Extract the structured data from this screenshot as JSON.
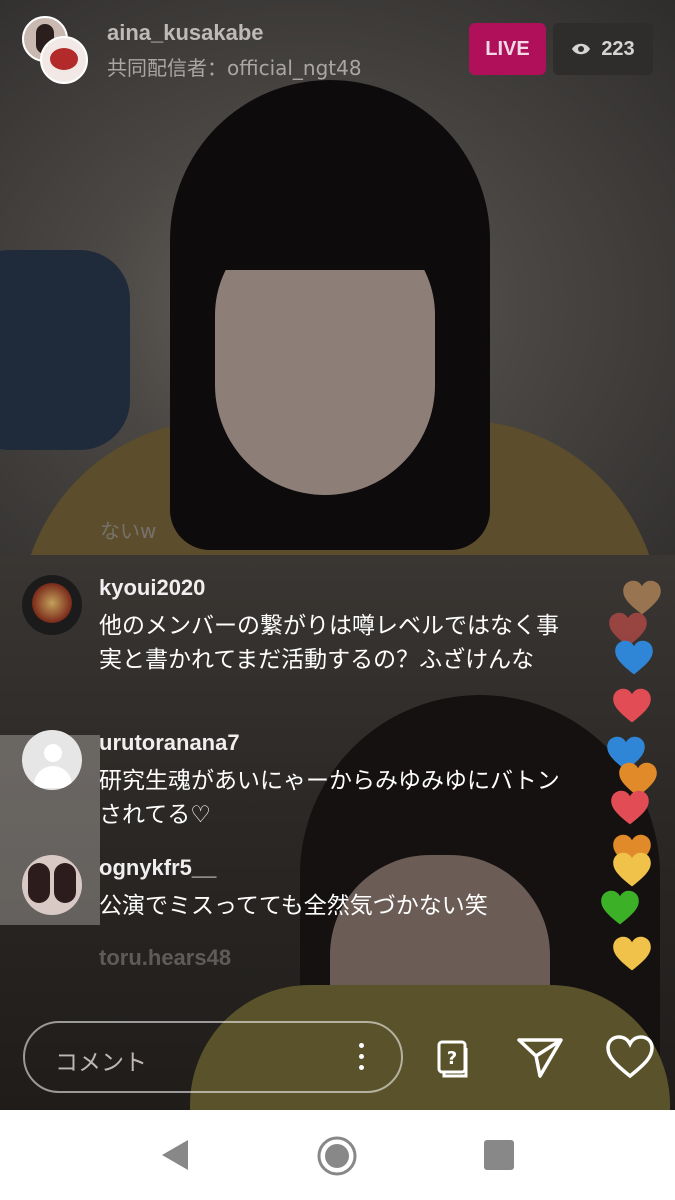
{
  "header": {
    "host_name": "aina_kusakabe",
    "cohost": "共同配信者：official_ngt48",
    "live_label": "LIVE",
    "viewer_count": "223"
  },
  "faded_comment": "ないw",
  "comments": [
    {
      "user": "kyoui2020",
      "text": "他のメンバーの繋がりは噂レベルではなく事実と書かれてまだ活動するの？ふざけんな"
    },
    {
      "user": "urutoranana7",
      "text": "研究生魂があいにゃーからみゆみゆにバトンされてる♡"
    },
    {
      "user": "ognykfr5__",
      "text": "公演でミスってても全然気づかない笑"
    },
    {
      "user": "toru.hears48",
      "text": ""
    }
  ],
  "hearts_colors": [
    "#d9a066",
    "#d9504c",
    "#2f86d6",
    "#e24c55",
    "#2f86d6",
    "#e08a2a",
    "#e24c55",
    "#e08a2a",
    "#f0c24a",
    "#3cb026",
    "#f0c24a"
  ],
  "composer": {
    "placeholder": "コメント"
  },
  "icons": {
    "eye": "eye-icon",
    "more": "more-vertical-icon",
    "qa": "question-box-icon",
    "send": "paper-plane-icon",
    "like": "heart-outline-icon",
    "back": "nav-back-icon",
    "home": "nav-home-icon",
    "recent": "nav-recent-icon"
  }
}
